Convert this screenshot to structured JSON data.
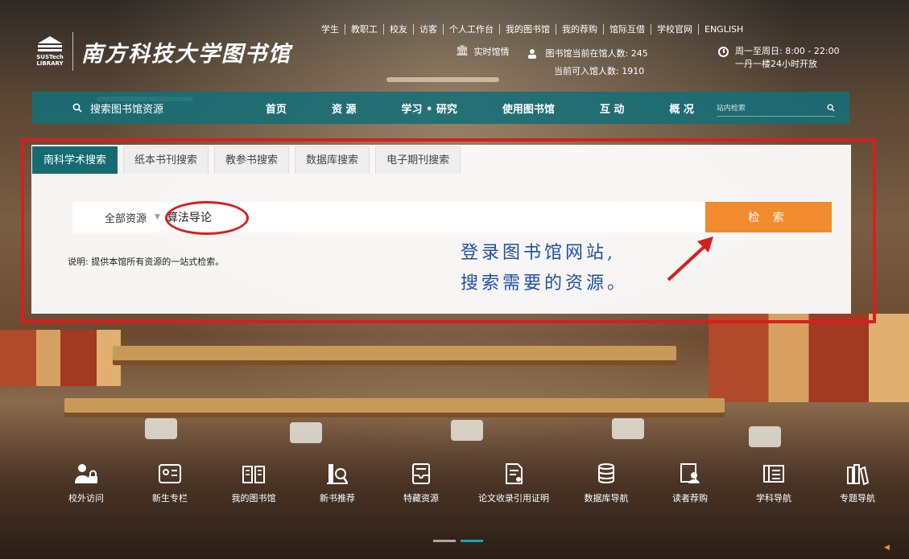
{
  "header": {
    "logo_text": "SUSTech LIBRARY",
    "library_name": "南方科技大学图书馆",
    "top_links": [
      "学生",
      "教职工",
      "校友",
      "访客",
      "个人工作台",
      "我的图书馆",
      "我的荐购",
      "馆际互借",
      "学校官网",
      "ENGLISH"
    ],
    "realtime_label": "实时馆情",
    "occupancy_current": "图书馆当前在馆人数: 245",
    "occupancy_available": "当前可入馆人数: 1910",
    "hours_line1": "周一至周日: 8:00 - 22:00",
    "hours_line2": "一丹一楼24小时开放"
  },
  "nav": {
    "search_label": "搜索图书馆资源",
    "items": [
      "首页",
      "资 源",
      "学习 • 研究",
      "使用图书馆",
      "互 动",
      "概 况"
    ],
    "site_search_placeholder": "站内检索"
  },
  "search_panel": {
    "tabs": [
      "南科学术搜索",
      "纸本书刊搜索",
      "教参书搜索",
      "数据库搜索",
      "电子期刊搜索"
    ],
    "active_tab": 0,
    "scope": "全部资源",
    "query": "算法导论",
    "button": "检 索",
    "note": "说明: 提供本馆所有资源的一站式检索。"
  },
  "annotation": {
    "line1": "登录图书馆网站,",
    "line2": "搜索需要的资源。",
    "color": "#1f4fa5",
    "highlight_color": "#d61f1f"
  },
  "quick_links": [
    {
      "label": "校外访问",
      "icon": "person-lock-icon"
    },
    {
      "label": "新生专栏",
      "icon": "id-card-icon"
    },
    {
      "label": "我的图书馆",
      "icon": "open-book-icon"
    },
    {
      "label": "新书推荐",
      "icon": "book-search-icon"
    },
    {
      "label": "特藏资源",
      "icon": "archive-tray-icon"
    },
    {
      "label": "论文收录引用证明",
      "icon": "document-certificate-icon"
    },
    {
      "label": "数据库导航",
      "icon": "database-icon"
    },
    {
      "label": "读者荐购",
      "icon": "reader-recommend-icon"
    },
    {
      "label": "学科导航",
      "icon": "subject-nav-icon"
    },
    {
      "label": "专题导航",
      "icon": "books-shelf-icon"
    }
  ],
  "colors": {
    "nav_teal": "#146e78",
    "accent_orange": "#f28a2e"
  }
}
